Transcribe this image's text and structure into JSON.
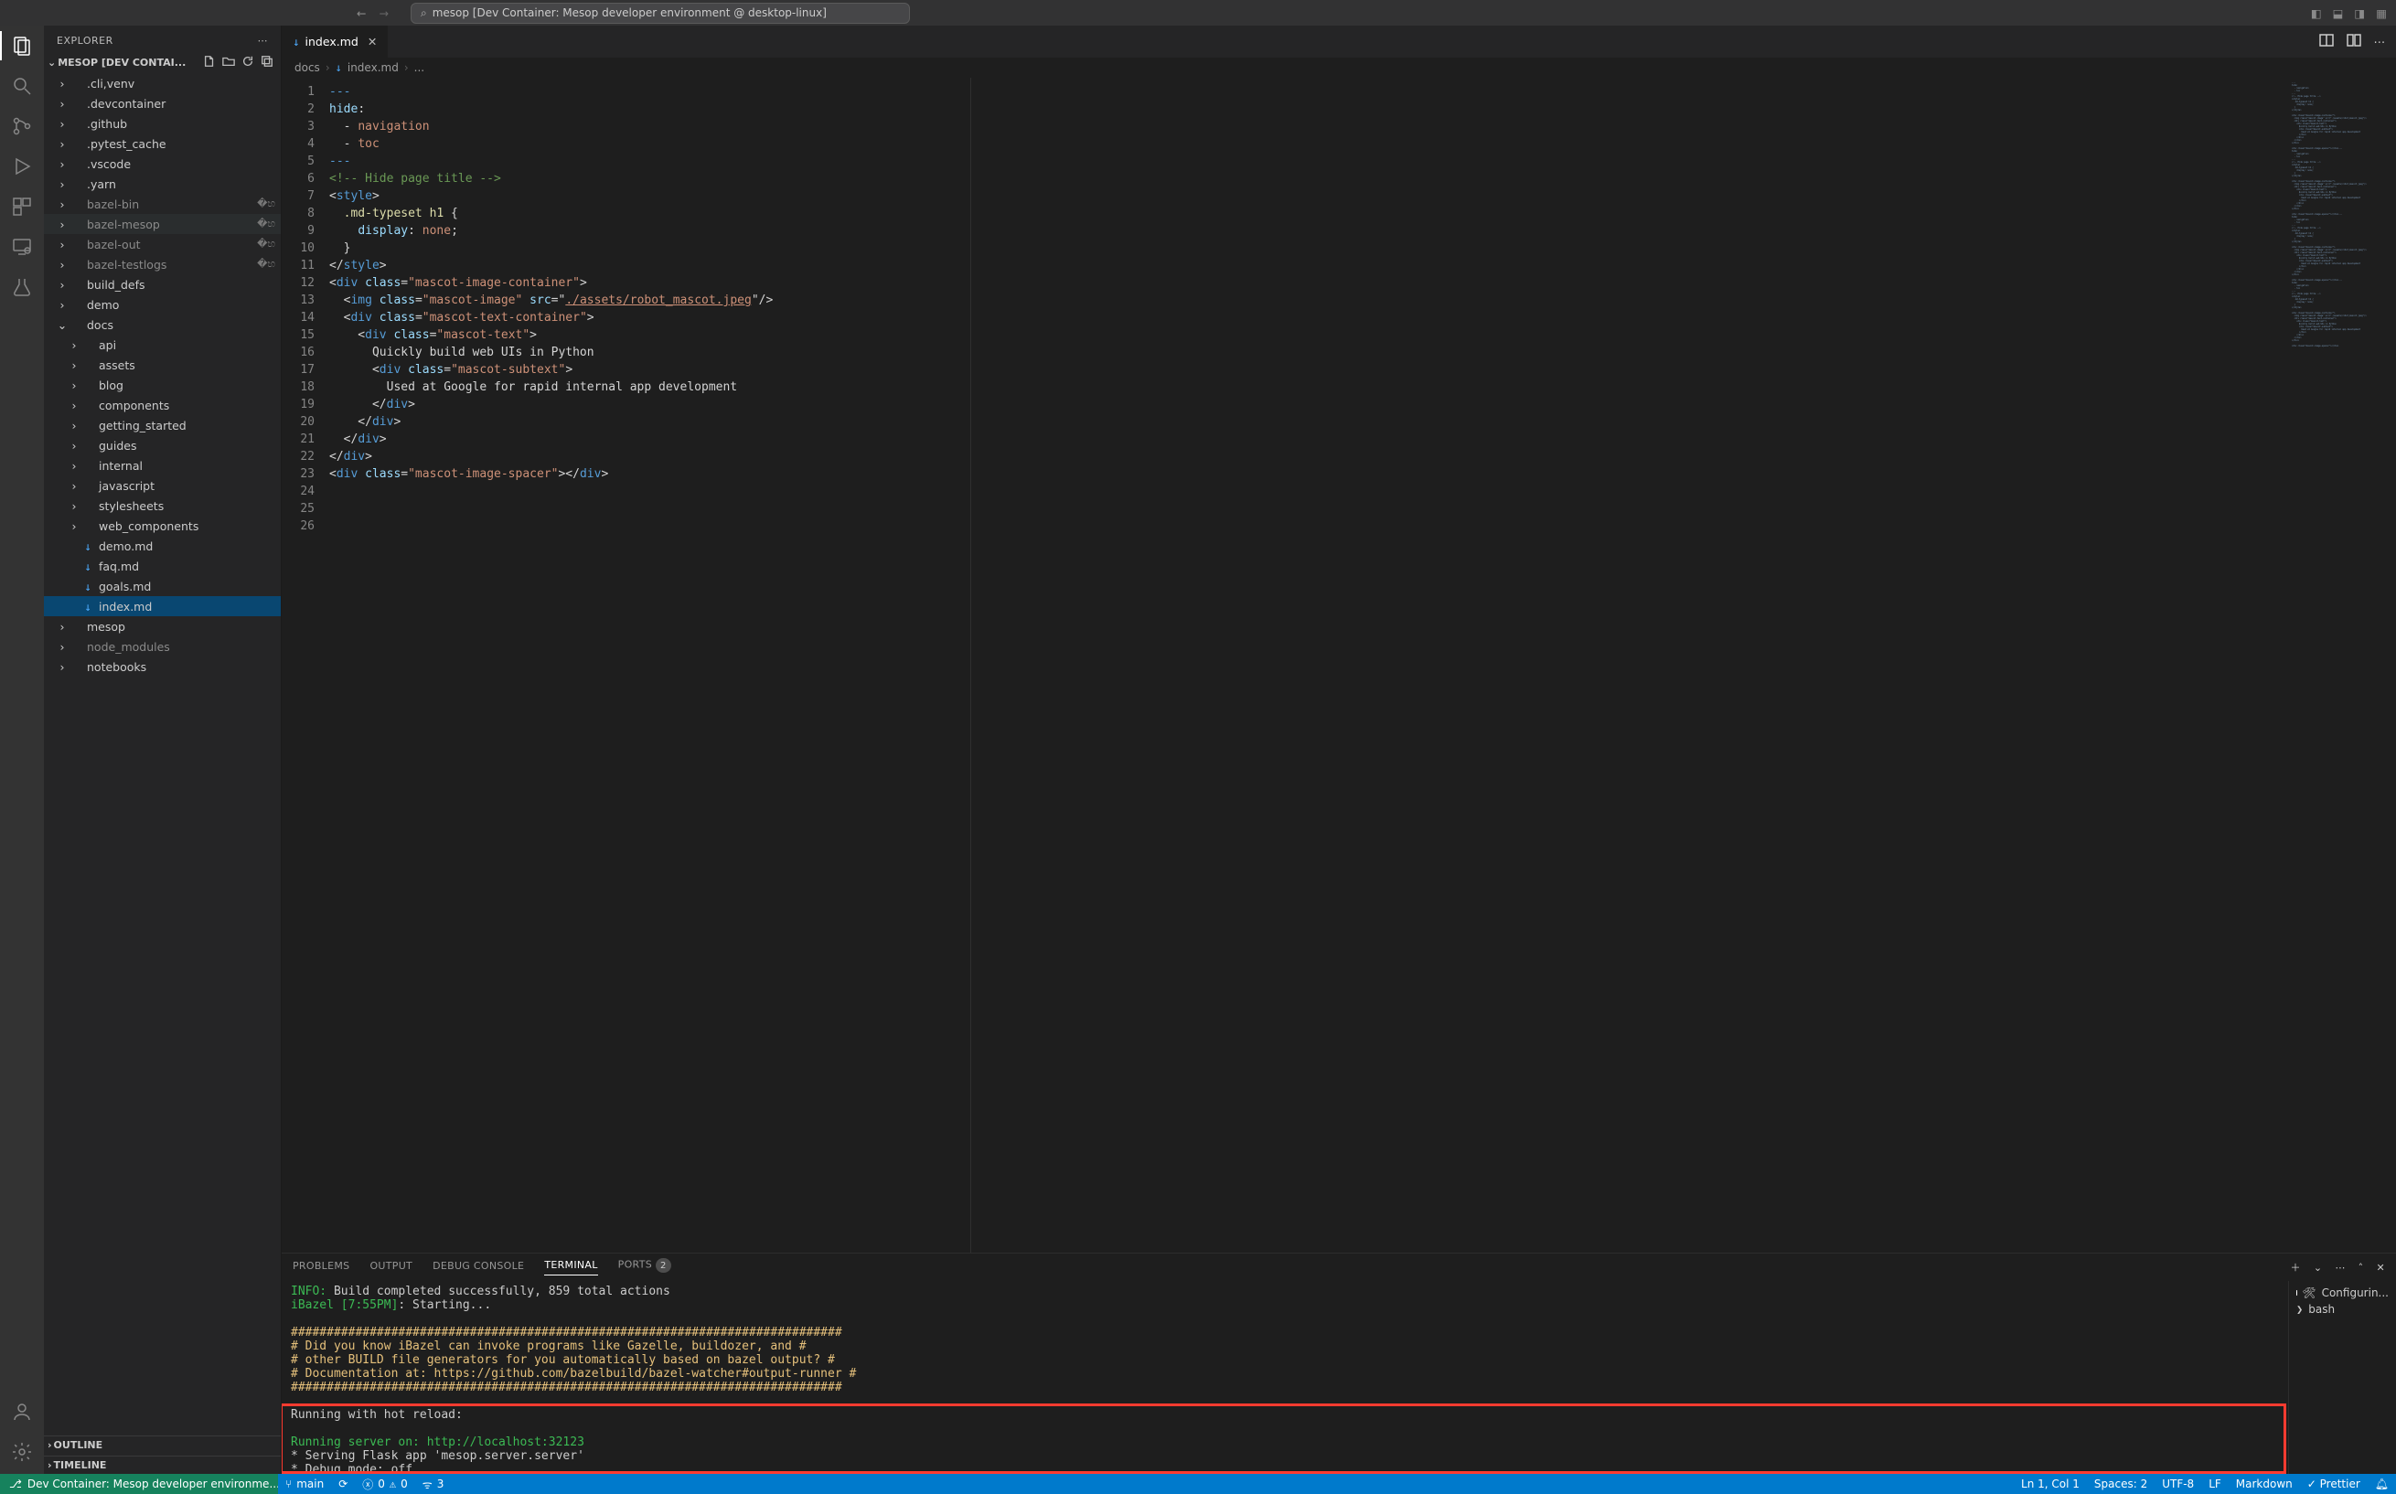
{
  "title_search": "mesop [Dev Container: Mesop developer environment @ desktop-linux]",
  "explorer_label": "EXPLORER",
  "workspace_label": "MESOP [DEV CONTAI...",
  "tree": [
    {
      "d": 1,
      "t": "folder",
      "n": ".cli,venv"
    },
    {
      "d": 1,
      "t": "folder",
      "n": ".devcontainer"
    },
    {
      "d": 1,
      "t": "folder",
      "n": ".github"
    },
    {
      "d": 1,
      "t": "folder",
      "n": ".pytest_cache"
    },
    {
      "d": 1,
      "t": "folder",
      "n": ".vscode"
    },
    {
      "d": 1,
      "t": "folder",
      "n": ".yarn"
    },
    {
      "d": 1,
      "t": "folder",
      "n": "bazel-bin",
      "sym": true,
      "link": true
    },
    {
      "d": 1,
      "t": "folder",
      "n": "bazel-mesop",
      "sym": true,
      "link": true,
      "hover": true
    },
    {
      "d": 1,
      "t": "folder",
      "n": "bazel-out",
      "sym": true,
      "link": true
    },
    {
      "d": 1,
      "t": "folder",
      "n": "bazel-testlogs",
      "sym": true,
      "link": true
    },
    {
      "d": 1,
      "t": "folder",
      "n": "build_defs"
    },
    {
      "d": 1,
      "t": "folder",
      "n": "demo"
    },
    {
      "d": 1,
      "t": "folderopen",
      "n": "docs"
    },
    {
      "d": 2,
      "t": "folder",
      "n": "api"
    },
    {
      "d": 2,
      "t": "folder",
      "n": "assets"
    },
    {
      "d": 2,
      "t": "folder",
      "n": "blog"
    },
    {
      "d": 2,
      "t": "folder",
      "n": "components"
    },
    {
      "d": 2,
      "t": "folder",
      "n": "getting_started"
    },
    {
      "d": 2,
      "t": "folder",
      "n": "guides"
    },
    {
      "d": 2,
      "t": "folder",
      "n": "internal"
    },
    {
      "d": 2,
      "t": "folder",
      "n": "javascript"
    },
    {
      "d": 2,
      "t": "folder",
      "n": "stylesheets"
    },
    {
      "d": 2,
      "t": "folder",
      "n": "web_components"
    },
    {
      "d": 2,
      "t": "file",
      "n": "demo.md",
      "icon": "md"
    },
    {
      "d": 2,
      "t": "file",
      "n": "faq.md",
      "icon": "md"
    },
    {
      "d": 2,
      "t": "file",
      "n": "goals.md",
      "icon": "md"
    },
    {
      "d": 2,
      "t": "file",
      "n": "index.md",
      "icon": "md",
      "sel": true
    },
    {
      "d": 1,
      "t": "folder",
      "n": "mesop"
    },
    {
      "d": 1,
      "t": "folder",
      "n": "node_modules",
      "sym": true
    },
    {
      "d": 1,
      "t": "folder",
      "n": "notebooks"
    }
  ],
  "outline_label": "OUTLINE",
  "timeline_label": "TIMELINE",
  "tab_name": "index.md",
  "crumbs": [
    "docs",
    "index.md",
    "..."
  ],
  "gutter_start": 1,
  "gutter_end": 26,
  "code_lines": [
    [
      [
        "p",
        "---"
      ]
    ],
    [
      [
        "at",
        "hide"
      ],
      [
        "d",
        ":"
      ]
    ],
    [
      [
        "d",
        "  - "
      ],
      [
        "st",
        "navigation"
      ]
    ],
    [
      [
        "d",
        "  - "
      ],
      [
        "st",
        "toc"
      ]
    ],
    [
      [
        "p",
        "---"
      ]
    ],
    [
      [
        "cm",
        "<!-- Hide page title -->"
      ]
    ],
    [
      [
        "d",
        "<"
      ],
      [
        "tg",
        "style"
      ],
      [
        "d",
        ">"
      ]
    ],
    [
      [
        "d",
        "  "
      ],
      [
        "fn",
        ".md-typeset h1"
      ],
      [
        "d",
        " {"
      ]
    ],
    [
      [
        "d",
        "    "
      ],
      [
        "at",
        "display"
      ],
      [
        "d",
        ": "
      ],
      [
        "st",
        "none"
      ],
      [
        "d",
        ";"
      ]
    ],
    [
      [
        "d",
        "  }"
      ]
    ],
    [
      [
        "d",
        "</"
      ],
      [
        "tg",
        "style"
      ],
      [
        "d",
        ">"
      ]
    ],
    [
      [
        "d",
        ""
      ]
    ],
    [
      [
        "d",
        "<"
      ],
      [
        "tg",
        "div"
      ],
      [
        "d",
        " "
      ],
      [
        "at",
        "class"
      ],
      [
        "d",
        "="
      ],
      [
        "st",
        "\"mascot-image-container\""
      ],
      [
        "d",
        ">"
      ]
    ],
    [
      [
        "d",
        "  <"
      ],
      [
        "tg",
        "img"
      ],
      [
        "d",
        " "
      ],
      [
        "at",
        "class"
      ],
      [
        "d",
        "="
      ],
      [
        "st",
        "\"mascot-image\""
      ],
      [
        "d",
        " "
      ],
      [
        "at",
        "src"
      ],
      [
        "d",
        "=\""
      ],
      [
        "ul",
        "./assets/robot_mascot.jpeg"
      ],
      [
        "d",
        "\"/>"
      ]
    ],
    [
      [
        "d",
        "  <"
      ],
      [
        "tg",
        "div"
      ],
      [
        "d",
        " "
      ],
      [
        "at",
        "class"
      ],
      [
        "d",
        "="
      ],
      [
        "st",
        "\"mascot-text-container\""
      ],
      [
        "d",
        ">"
      ]
    ],
    [
      [
        "d",
        "    <"
      ],
      [
        "tg",
        "div"
      ],
      [
        "d",
        " "
      ],
      [
        "at",
        "class"
      ],
      [
        "d",
        "="
      ],
      [
        "st",
        "\"mascot-text\""
      ],
      [
        "d",
        ">"
      ]
    ],
    [
      [
        "d",
        "      Quickly build web UIs in Python"
      ]
    ],
    [
      [
        "d",
        "      <"
      ],
      [
        "tg",
        "div"
      ],
      [
        "d",
        " "
      ],
      [
        "at",
        "class"
      ],
      [
        "d",
        "="
      ],
      [
        "st",
        "\"mascot-subtext\""
      ],
      [
        "d",
        ">"
      ]
    ],
    [
      [
        "d",
        "        Used at Google for rapid internal app development"
      ]
    ],
    [
      [
        "d",
        "      </"
      ],
      [
        "tg",
        "div"
      ],
      [
        "d",
        ">"
      ]
    ],
    [
      [
        "d",
        "    </"
      ],
      [
        "tg",
        "div"
      ],
      [
        "d",
        ">"
      ]
    ],
    [
      [
        "d",
        "  </"
      ],
      [
        "tg",
        "div"
      ],
      [
        "d",
        ">"
      ]
    ],
    [
      [
        "d",
        "</"
      ],
      [
        "tg",
        "div"
      ],
      [
        "d",
        ">"
      ]
    ],
    [
      [
        "d",
        ""
      ]
    ],
    [
      [
        "d",
        "<"
      ],
      [
        "tg",
        "div"
      ],
      [
        "d",
        " "
      ],
      [
        "at",
        "class"
      ],
      [
        "d",
        "="
      ],
      [
        "st",
        "\"mascot-image-spacer\""
      ],
      [
        "d",
        "></"
      ],
      [
        "tg",
        "div"
      ],
      [
        "d",
        ">"
      ]
    ]
  ],
  "panel_tabs": [
    "PROBLEMS",
    "OUTPUT",
    "DEBUG CONSOLE",
    "TERMINAL",
    "PORTS"
  ],
  "panel_active": 3,
  "ports_badge": "2",
  "termside": [
    {
      "n": "Configurin...",
      "icon": "wrench"
    },
    {
      "n": "bash",
      "icon": "bash"
    }
  ],
  "terminal": [
    {
      "cls": "g",
      "t": "INFO:"
    },
    {
      "cls": "d",
      "t": " Build completed successfully, 859 total actions"
    },
    "\n",
    {
      "cls": "g",
      "t": "iBazel [7:55PM]"
    },
    {
      "cls": "d",
      "t": ": Starting..."
    },
    "\n",
    "\n",
    {
      "cls": "y",
      "t": "#############################################################################"
    },
    "\n",
    {
      "cls": "y",
      "t": "# Did you know iBazel can invoke programs like Gazelle, buildozer, and      #"
    },
    "\n",
    {
      "cls": "y",
      "t": "# other BUILD file generators for you automatically based on bazel output?  #"
    },
    "\n",
    {
      "cls": "y",
      "t": "# Documentation at: https://github.com/bazelbuild/bazel-watcher#output-runner #"
    },
    "\n",
    {
      "cls": "y",
      "t": "#############################################################################"
    },
    "\n",
    "\n",
    {
      "cls": "d",
      "t": "Running with hot reload:"
    },
    "\n",
    "\n",
    {
      "cls": "g",
      "t": "Running server on: http://localhost:32123"
    },
    "\n",
    {
      "cls": "d",
      "t": " * Serving Flask app 'mesop.server.server'"
    },
    "\n",
    {
      "cls": "d",
      "t": " * Debug mode: off"
    }
  ],
  "status": {
    "remote": "Dev Container: Mesop developer environme...",
    "branch": "main",
    "sync": "⟳",
    "errors": "0",
    "warnings": "0",
    "ports": "3",
    "right": [
      "Ln 1, Col 1",
      "Spaces: 2",
      "UTF-8",
      "LF",
      "Markdown",
      "✓ Prettier"
    ]
  }
}
